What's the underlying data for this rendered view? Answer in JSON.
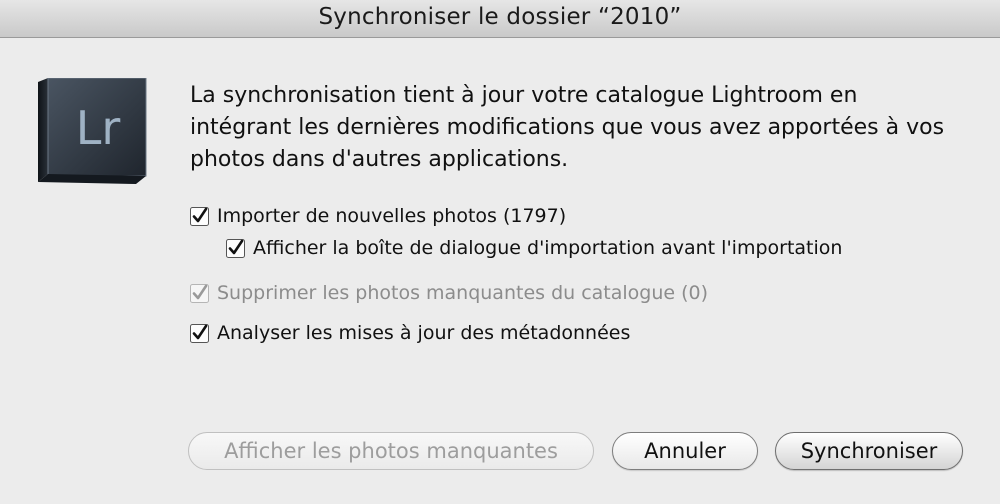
{
  "window": {
    "title": "Synchroniser le dossier “2010”"
  },
  "app_icon": {
    "icon": "lightroom-app-icon",
    "text": "Lr"
  },
  "message": "La synchronisation tient à jour votre catalogue Lightroom en intégrant les dernières modifications que vous avez apportées à vos photos dans d'autres applications.",
  "options": [
    {
      "label": "Importer de nouvelles photos (1797)",
      "checked": true,
      "enabled": true
    },
    {
      "label": "Afficher la boîte de dialogue d'importation avant l'importation",
      "checked": true,
      "enabled": true
    },
    {
      "label": "Supprimer les photos manquantes du catalogue (0)",
      "checked": true,
      "enabled": false
    },
    {
      "label": "Analyser les mises à jour des métadonnées",
      "checked": true,
      "enabled": true
    }
  ],
  "buttons": {
    "show_missing": "Afficher les photos manquantes",
    "cancel": "Annuler",
    "synchronize": "Synchroniser"
  },
  "colors": {
    "background": "#ececec",
    "disabled_text": "#8c8c8c",
    "icon_dark": "#2e3640"
  }
}
